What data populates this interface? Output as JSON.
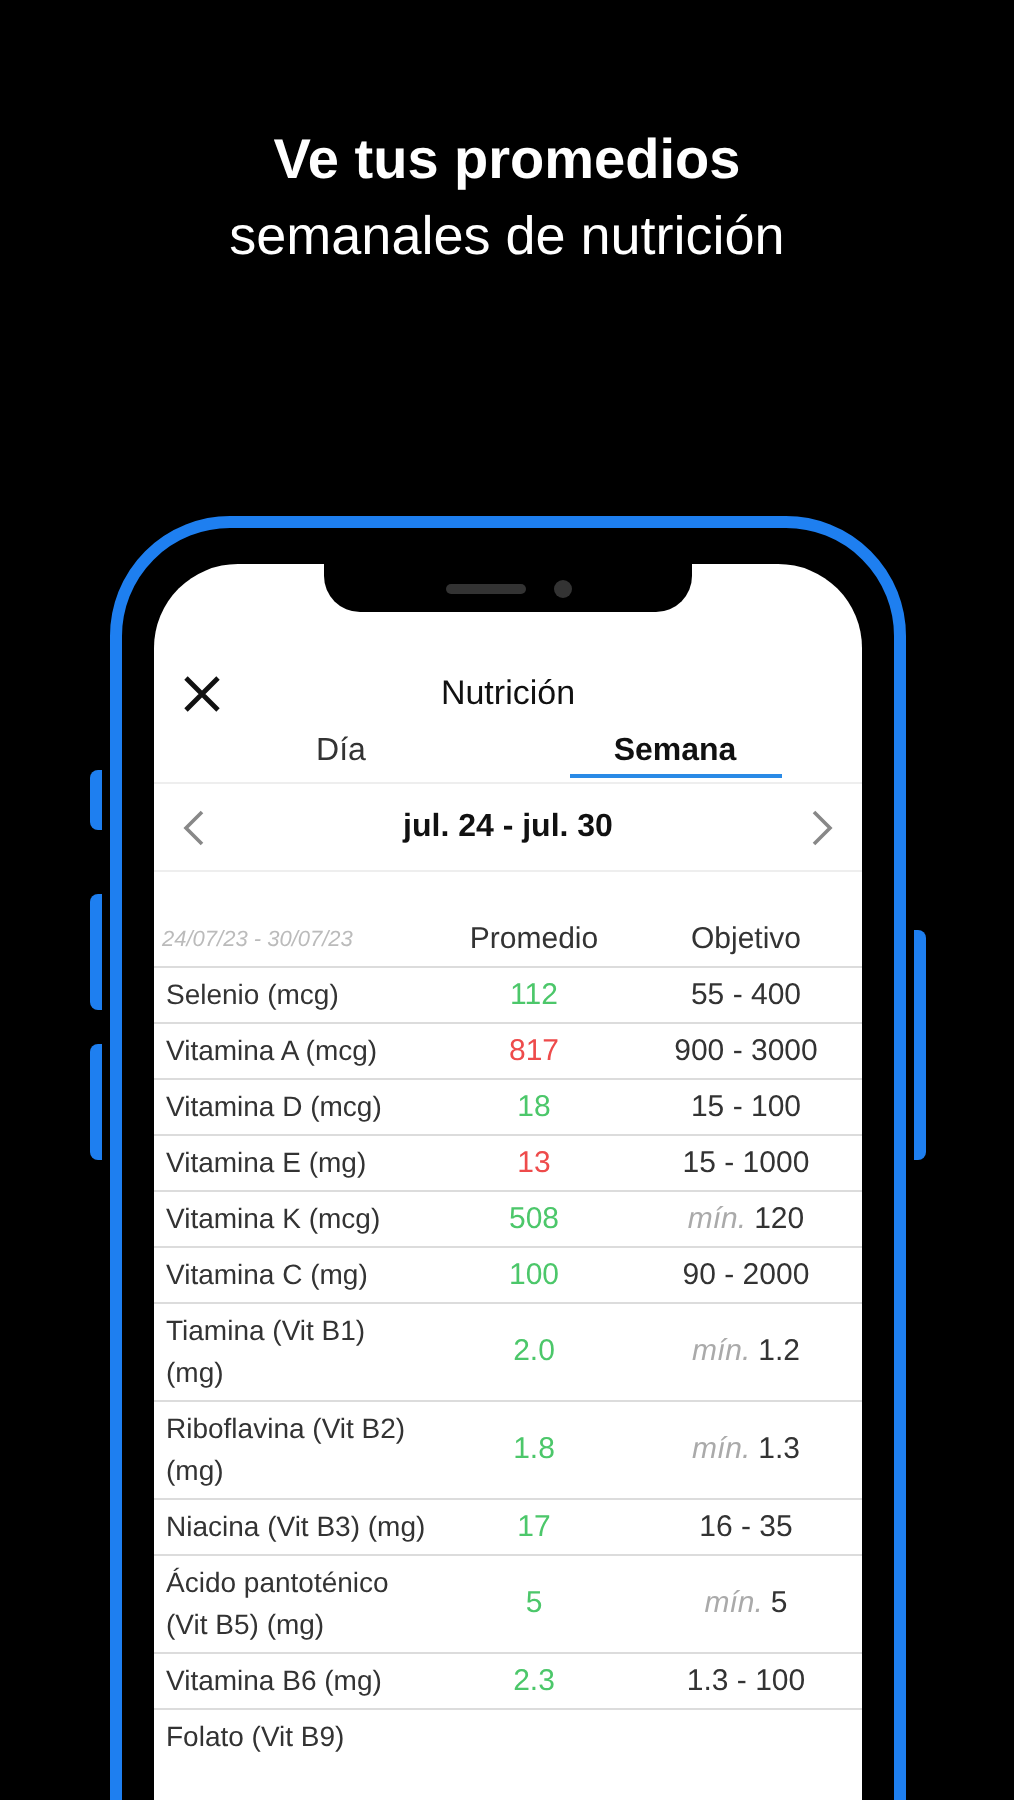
{
  "headline": {
    "title": "Ve tus promedios",
    "subtitle": "semanales de nutrición"
  },
  "screen": {
    "title": "Nutrición",
    "tabs": [
      {
        "label": "Día",
        "selected": false
      },
      {
        "label": "Semana",
        "selected": true
      }
    ],
    "week": "jul. 24 - jul. 30",
    "table": {
      "columns": [
        "24/07/23 - 30/07/23",
        "Promedio",
        "Objetivo"
      ],
      "rows": [
        {
          "name": "Selenio (mcg)",
          "average": "112",
          "color": "#4cc76a",
          "kind": "range",
          "target": "55 - 400"
        },
        {
          "name": "Vitamina A (mcg)",
          "average": "817",
          "color": "#ee4b4b",
          "kind": "range",
          "target": "900 - 3000"
        },
        {
          "name": "Vitamina D (mcg)",
          "average": "18",
          "color": "#4cc76a",
          "kind": "range",
          "target": "15 - 100"
        },
        {
          "name": "Vitamina E (mg)",
          "average": "13",
          "color": "#ee4b4b",
          "kind": "range",
          "target": "15 - 1000"
        },
        {
          "name": "Vitamina K (mcg)",
          "average": "508",
          "color": "#4cc76a",
          "kind": "min",
          "target_prefix": "mín.",
          "target": "120"
        },
        {
          "name": "Vitamina C (mg)",
          "average": "100",
          "color": "#4cc76a",
          "kind": "range",
          "target": "90 - 2000"
        },
        {
          "name": "Tiamina (Vit B1) (mg)",
          "average": "2.0",
          "color": "#4cc76a",
          "kind": "min",
          "target_prefix": "mín.",
          "target": "1.2"
        },
        {
          "name": "Riboflavina (Vit B2) (mg)",
          "average": "1.8",
          "color": "#4cc76a",
          "kind": "min",
          "target_prefix": "mín.",
          "target": "1.3"
        },
        {
          "name": "Niacina (Vit B3) (mg)",
          "average": "17",
          "color": "#4cc76a",
          "kind": "range",
          "target": "16 - 35"
        },
        {
          "name": "Ácido pantoténico (Vit B5) (mg)",
          "average": "5",
          "color": "#4cc76a",
          "kind": "min",
          "target_prefix": "mín.",
          "target": "5"
        },
        {
          "name": "Vitamina B6 (mg)",
          "average": "2.3",
          "color": "#4cc76a",
          "kind": "range",
          "target": "1.3 - 100"
        },
        {
          "name": "Folato (Vit B9)"
        }
      ]
    }
  }
}
